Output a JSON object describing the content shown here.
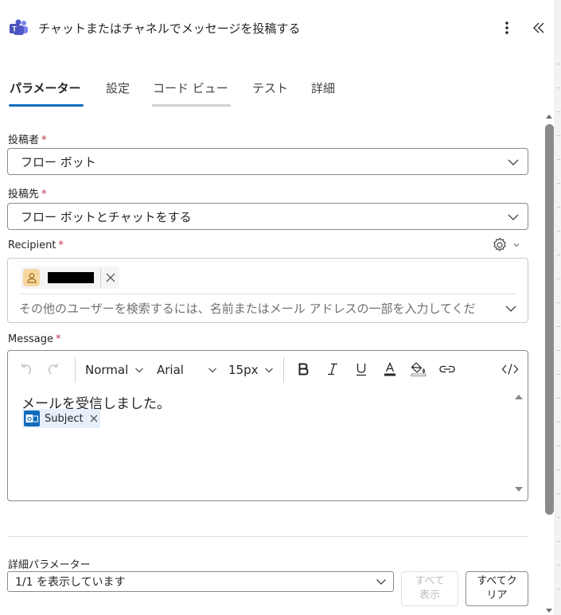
{
  "header": {
    "title": "チャットまたはチャネルでメッセージを投稿する",
    "app_icon": "teams-icon",
    "more_icon": "more-vertical-icon",
    "collapse_icon": "double-chevron-left-icon"
  },
  "tabs": [
    {
      "label": "パラメーター",
      "active": true
    },
    {
      "label": "設定",
      "active": false
    },
    {
      "label": "コード ビュー",
      "active": false
    },
    {
      "label": "テスト",
      "active": false
    },
    {
      "label": "詳細",
      "active": false
    }
  ],
  "form": {
    "post_as": {
      "label": "投稿者",
      "required_mark": "*",
      "value": "フロー ボット"
    },
    "post_in": {
      "label": "投稿先",
      "required_mark": "*",
      "value": "フロー ボットとチャットをする"
    },
    "recipient": {
      "label": "Recipient",
      "required_mark": "*",
      "placeholder": "その他のユーザーを検索するには、名前またはメール アドレスの一部を入力してくだ",
      "settings_icon": "gear-icon"
    },
    "message": {
      "label": "Message",
      "required_mark": "*",
      "toolbar": {
        "format": "Normal",
        "font": "Arial",
        "size": "15px"
      },
      "body_text": "メールを受信しました。",
      "token_label": "Subject"
    }
  },
  "advanced": {
    "label": "詳細パラメーター",
    "select_value": "1/1 を表示しています",
    "show_all_line1": "すべて",
    "show_all_line2": "表示",
    "clear_all_line1": "すべてク",
    "clear_all_line2": "リア"
  },
  "colors": {
    "accent": "#0f6cbd",
    "required": "#c4314b",
    "tab_underline": "#0f6cbd"
  }
}
